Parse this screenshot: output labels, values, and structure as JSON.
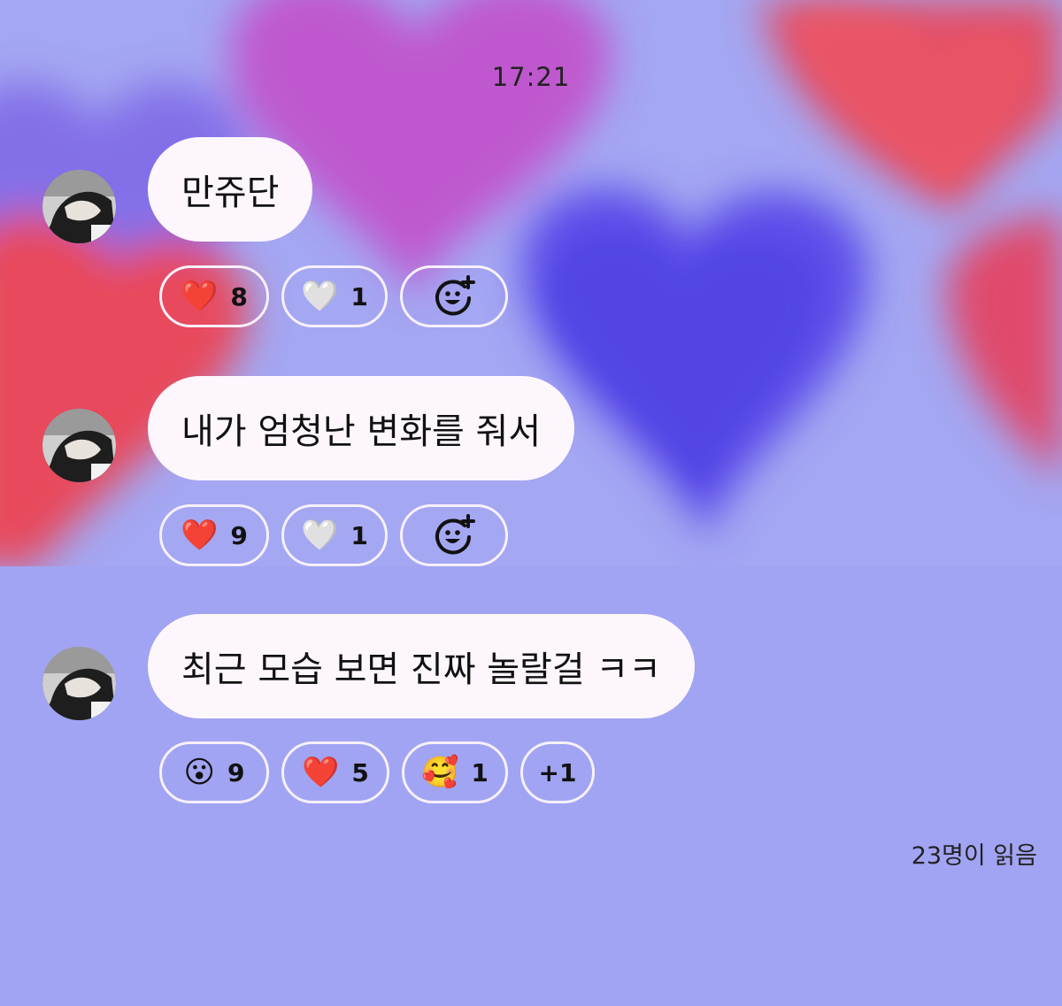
{
  "timestamp": "17:21",
  "messages": [
    {
      "text": "만쥬단",
      "reactions": [
        {
          "emoji": "❤️",
          "count": "8",
          "icon": "red-heart-icon"
        },
        {
          "emoji": "🤍",
          "count": "1",
          "icon": "white-heart-icon"
        },
        {
          "icon": "add-reaction-icon"
        }
      ]
    },
    {
      "text": "내가 엄청난 변화를 줘서",
      "reactions": [
        {
          "emoji": "❤️",
          "count": "9",
          "icon": "red-heart-icon"
        },
        {
          "emoji": "🤍",
          "count": "1",
          "icon": "white-heart-icon"
        },
        {
          "icon": "add-reaction-icon"
        }
      ]
    },
    {
      "text": "최근 모습 보면 진짜 놀랄걸 ㅋㅋ",
      "reactions": [
        {
          "emoji": "😮",
          "count": "9",
          "icon": "surprised-face-icon"
        },
        {
          "emoji": "❤️",
          "count": "5",
          "icon": "red-heart-icon"
        },
        {
          "emoji": "🥰",
          "count": "1",
          "icon": "smiling-face-with-hearts-icon"
        },
        {
          "label": "+1"
        }
      ]
    }
  ],
  "read_count": "23명이 읽음",
  "colors": {
    "background": "#a3a6f3",
    "bubble": "#fdf7fd",
    "chip_border": "#f6f0fb",
    "heart_red": "#e9465e",
    "heart_violet": "#5a4de8"
  }
}
